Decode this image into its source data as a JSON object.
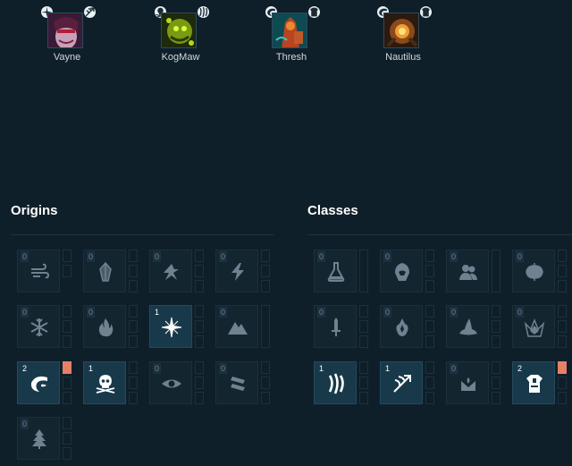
{
  "colors": {
    "background": "#0f1f2a",
    "tile": "#13252f",
    "tile_active": "#18394a",
    "icon_muted": "#6f8290",
    "icon_active": "#ffffff",
    "slot_filled": "#e58066"
  },
  "champions": [
    {
      "name": "Vayne",
      "trait_icons": [
        "light-icon",
        "ranger-icon"
      ]
    },
    {
      "name": "KogMaw",
      "trait_icons": [
        "poison-icon",
        "predator-icon"
      ]
    },
    {
      "name": "Thresh",
      "trait_icons": [
        "ocean-icon",
        "warden-icon"
      ]
    },
    {
      "name": "Nautilus",
      "trait_icons": [
        "ocean-icon",
        "warden-icon"
      ]
    }
  ],
  "origins": {
    "title": "Origins",
    "traits": [
      {
        "icon": "wind-icon",
        "count": "0",
        "active": false,
        "slots": 2
      },
      {
        "icon": "crystal-icon",
        "count": "0",
        "active": false,
        "slots": 3
      },
      {
        "icon": "cloud-icon",
        "count": "0",
        "active": false,
        "slots": 3
      },
      {
        "icon": "electric-icon",
        "count": "0",
        "active": false,
        "slots": 3
      },
      {
        "icon": "ice-icon",
        "count": "0",
        "active": false,
        "slots": 3
      },
      {
        "icon": "inferno-icon",
        "count": "0",
        "active": false,
        "slots": 3
      },
      {
        "icon": "light-icon",
        "count": "1",
        "active": true,
        "slots": 3
      },
      {
        "icon": "mountain-icon",
        "count": "0",
        "active": false,
        "slots": 1
      },
      {
        "icon": "ocean-icon",
        "count": "2",
        "active": true,
        "slots": 3,
        "filled": 1
      },
      {
        "icon": "poison-icon",
        "count": "1",
        "active": true,
        "slots": 3
      },
      {
        "icon": "shadow-icon",
        "count": "0",
        "active": false,
        "slots": 3
      },
      {
        "icon": "steel-icon",
        "count": "0",
        "active": false,
        "slots": 3
      },
      {
        "icon": "woodland-icon",
        "count": "0",
        "active": false,
        "slots": 3
      }
    ]
  },
  "classes": {
    "title": "Classes",
    "traits": [
      {
        "icon": "alchemist-icon",
        "count": "0",
        "active": false,
        "slots": 1
      },
      {
        "icon": "assassin-icon",
        "count": "0",
        "active": false,
        "slots": 3
      },
      {
        "icon": "avatar-icon",
        "count": "0",
        "active": false,
        "slots": 1
      },
      {
        "icon": "berserker-icon",
        "count": "0",
        "active": false,
        "slots": 3
      },
      {
        "icon": "blademaster-icon",
        "count": "0",
        "active": false,
        "slots": 3
      },
      {
        "icon": "druid-icon",
        "count": "0",
        "active": false,
        "slots": 3
      },
      {
        "icon": "mage-icon",
        "count": "0",
        "active": false,
        "slots": 3
      },
      {
        "icon": "mystic-icon",
        "count": "0",
        "active": false,
        "slots": 3
      },
      {
        "icon": "predator-icon",
        "count": "1",
        "active": true,
        "slots": 3
      },
      {
        "icon": "ranger-icon",
        "count": "1",
        "active": true,
        "slots": 3
      },
      {
        "icon": "summoner-icon",
        "count": "0",
        "active": false,
        "slots": 3
      },
      {
        "icon": "warden-icon",
        "count": "2",
        "active": true,
        "slots": 3,
        "filled": 1
      }
    ]
  }
}
